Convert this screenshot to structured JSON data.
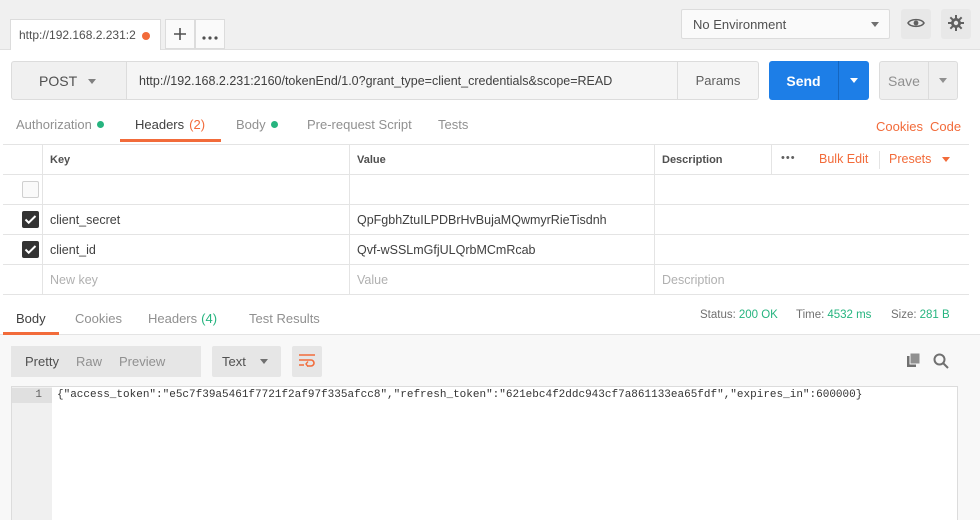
{
  "tab": {
    "title": "http://192.168.2.231:2"
  },
  "environment": {
    "selected": "No Environment"
  },
  "request": {
    "method": "POST",
    "url": "http://192.168.2.231:2160/tokenEnd/1.0?grant_type=client_credentials&scope=READ",
    "params_label": "Params",
    "send_label": "Send",
    "save_label": "Save"
  },
  "request_tabs": {
    "authorization": "Authorization",
    "headers": "Headers",
    "headers_count": "(2)",
    "body": "Body",
    "prerequest": "Pre-request Script",
    "tests": "Tests",
    "cookies": "Cookies",
    "code": "Code"
  },
  "headers_table": {
    "col_key": "Key",
    "col_value": "Value",
    "col_description": "Description",
    "more": "•••",
    "bulk_edit": "Bulk Edit",
    "presets": "Presets",
    "rows": [
      {
        "key": "client_secret",
        "value": "QpFgbhZtuILPDBrHvBujaMQwmyrRieTisdnh",
        "checked": true
      },
      {
        "key": "client_id",
        "value": "Qvf-wSSLmGfjULQrbMCmRcab",
        "checked": true
      }
    ],
    "new_key_placeholder": "New key",
    "new_value_placeholder": "Value",
    "new_description_placeholder": "Description"
  },
  "response_tabs": {
    "body": "Body",
    "cookies": "Cookies",
    "headers": "Headers",
    "headers_count": "(4)",
    "test_results": "Test Results"
  },
  "response_status": {
    "status_label": "Status:",
    "status_value": "200 OK",
    "time_label": "Time:",
    "time_value": "4532 ms",
    "size_label": "Size:",
    "size_value": "281 B"
  },
  "response_view": {
    "pretty": "Pretty",
    "raw": "Raw",
    "preview": "Preview",
    "format": "Text"
  },
  "response_body": {
    "line_number": "1",
    "content": "{\"access_token\":\"e5c7f39a5461f7721f2af97f335afcc8\",\"refresh_token\":\"621ebc4f2ddc943cf7a861133ea65fdf\",\"expires_in\":600000}"
  },
  "colors": {
    "accent": "#f26b3a",
    "primary": "#1d7ee7",
    "success": "#26b47f"
  }
}
